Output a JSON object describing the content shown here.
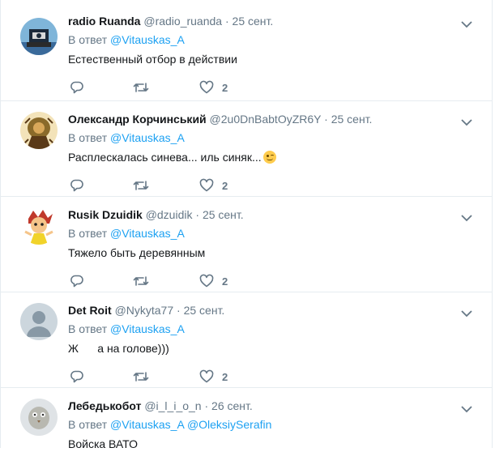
{
  "tweets": [
    {
      "name": "radio Ruanda",
      "handle": "@radio_ruanda",
      "dot": "·",
      "time": "25 сент.",
      "reply_prefix": "В ответ",
      "reply_to": "@Vitauskas_A",
      "reply_to_2": "",
      "text": "Естественный отбор в действии",
      "likes": "2",
      "avatar": "avatar-radio-ruanda"
    },
    {
      "name": "Олександр Корчинський",
      "handle": "@2u0DnBabtOyZR6Y",
      "dot": "·",
      "time": "25 сент.",
      "reply_prefix": "В ответ",
      "reply_to": "@Vitauskas_A",
      "reply_to_2": "",
      "text": "Расплескалась синева... иль синяк...",
      "emoji": "winking-face-emoji",
      "likes": "2",
      "avatar": "avatar-korchynskyi"
    },
    {
      "name": "Rusik Dzuidik",
      "handle": "@dzuidik",
      "dot": "·",
      "time": "25 сент.",
      "reply_prefix": "В ответ",
      "reply_to": "@Vitauskas_A",
      "reply_to_2": "",
      "text": "Тяжело быть деревянным",
      "likes": "2",
      "avatar": "avatar-rusik"
    },
    {
      "name": "Det Roit",
      "handle": "@Nykyta77",
      "dot": "·",
      "time": "25 сент.",
      "reply_prefix": "В ответ",
      "reply_to": "@Vitauskas_A",
      "reply_to_2": "",
      "text": "Ж      а на голове)))",
      "likes": "2",
      "avatar": "avatar-default"
    },
    {
      "name": "Лебедькобот",
      "handle": "@i_l_i_o_n",
      "dot": "·",
      "time": "26 сент.",
      "reply_prefix": "В ответ",
      "reply_to": "@Vitauskas_A",
      "reply_to_2": "@OleksiySerafin",
      "text": "Войска ВАТО",
      "likes": "",
      "avatar": "avatar-lebedkobot"
    }
  ],
  "colors": {
    "link": "#1da1f2",
    "muted": "#657786",
    "text": "#14171a",
    "border": "#e6ecf0"
  },
  "icons": {
    "reply": "reply-icon",
    "retweet": "retweet-icon",
    "like": "heart-icon",
    "more": "chevron-down-icon"
  }
}
